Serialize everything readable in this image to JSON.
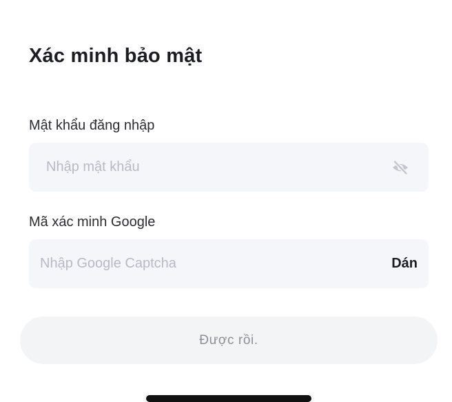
{
  "header": {
    "title": "Xác minh bảo mật"
  },
  "password_field": {
    "label": "Mật khẩu đăng nhập",
    "placeholder": "Nhập mật khẩu",
    "value": "",
    "toggle_icon": "eye-off-icon"
  },
  "google_field": {
    "label": "Mã xác minh Google",
    "placeholder": "Nhập Google Captcha",
    "value": "",
    "paste_label": "Dán"
  },
  "confirm": {
    "label": "Được rồi."
  },
  "colors": {
    "field_bg": "#f5f6fa",
    "placeholder": "#b7bac3",
    "button_bg": "#f3f4f6",
    "button_text": "#8d8f96",
    "text": "#1c1d22"
  }
}
